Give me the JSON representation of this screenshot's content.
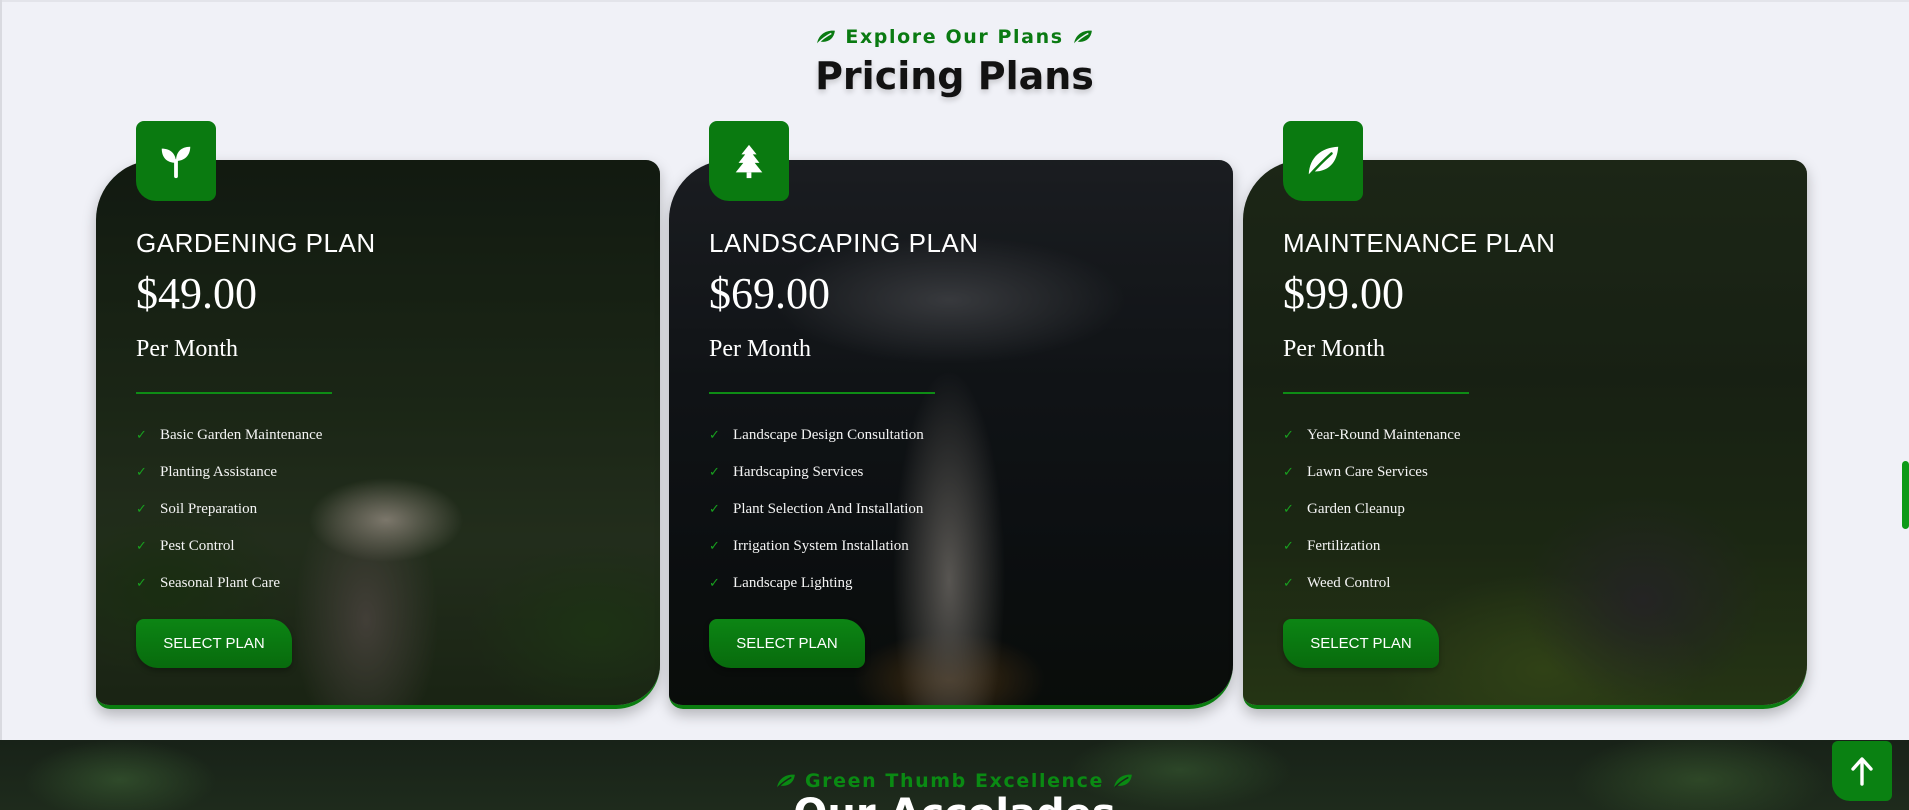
{
  "section": {
    "subtitle": "Explore Our Plans",
    "title": "Pricing Plans"
  },
  "plans": [
    {
      "icon": "sprout-icon",
      "name": "GARDENING PLAN",
      "price": "$49.00",
      "period": "Per Month",
      "features": [
        "Basic Garden Maintenance",
        "Planting Assistance",
        "Soil Preparation",
        "Pest Control",
        "Seasonal Plant Care"
      ],
      "button": "SELECT PLAN"
    },
    {
      "icon": "tree-icon",
      "name": "LANDSCAPING PLAN",
      "price": "$69.00",
      "period": "Per Month",
      "features": [
        "Landscape Design Consultation",
        "Hardscaping Services",
        "Plant Selection And Installation",
        "Irrigation System Installation",
        "Landscape Lighting"
      ],
      "button": "SELECT PLAN"
    },
    {
      "icon": "leaf-icon",
      "name": "MAINTENANCE PLAN",
      "price": "$99.00",
      "period": "Per Month",
      "features": [
        "Year-Round Maintenance",
        "Lawn Care Services",
        "Garden Cleanup",
        "Fertilization",
        "Weed Control"
      ],
      "button": "SELECT PLAN"
    }
  ],
  "next_section": {
    "subtitle": "Green Thumb Excellence",
    "title": "Our Accolades"
  },
  "colors": {
    "accent": "#0a7a10",
    "background": "#f0f1f7"
  }
}
